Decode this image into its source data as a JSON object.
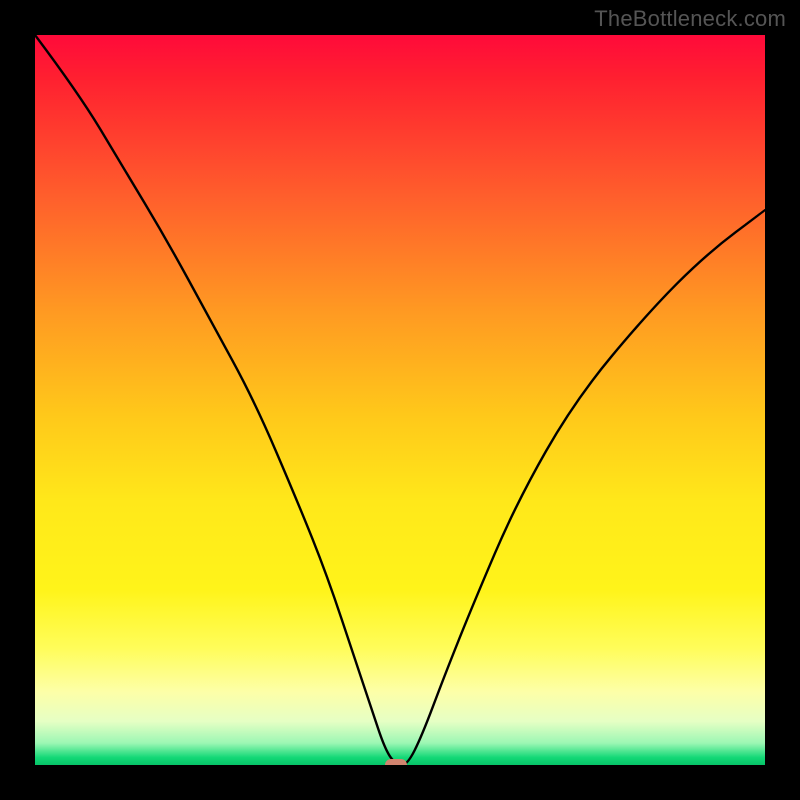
{
  "watermark": "TheBottleneck.com",
  "chart_data": {
    "type": "line",
    "title": "",
    "xlabel": "",
    "ylabel": "",
    "xlim": [
      0,
      100
    ],
    "ylim": [
      0,
      100
    ],
    "series": [
      {
        "name": "bottleneck-curve",
        "x": [
          0,
          6,
          12,
          18,
          24,
          30,
          36,
          40,
          44,
          46,
          48,
          49.5,
          51,
          53,
          56,
          60,
          66,
          74,
          84,
          92,
          100
        ],
        "y": [
          100,
          92,
          82,
          72,
          61,
          50,
          36,
          26,
          14,
          8,
          2,
          0,
          0,
          4,
          12,
          22,
          36,
          50,
          62,
          70,
          76
        ]
      }
    ],
    "marker": {
      "x": 49.5,
      "y": 0
    },
    "domain_note": "Values estimated from pixel positions on a 0–100 normalized grid; chart had no visible axis ticks."
  },
  "colors": {
    "gradient_top": "#ff0a3a",
    "gradient_bottom": "#07c268",
    "curve": "#000000",
    "marker": "#d1846f",
    "watermark": "#555555"
  }
}
